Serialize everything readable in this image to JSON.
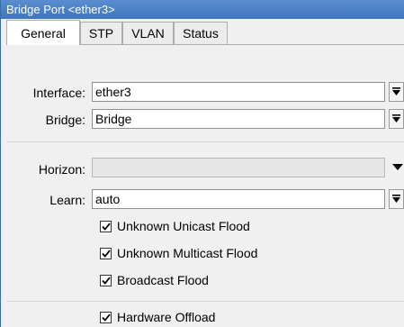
{
  "window": {
    "title": "Bridge Port <ether3>"
  },
  "tabs": [
    {
      "label": "General",
      "active": true
    },
    {
      "label": "STP",
      "active": false
    },
    {
      "label": "VLAN",
      "active": false
    },
    {
      "label": "Status",
      "active": false
    }
  ],
  "form": {
    "interface": {
      "label": "Interface:",
      "value": "ether3"
    },
    "bridge": {
      "label": "Bridge:",
      "value": "Bridge"
    },
    "horizon": {
      "label": "Horizon:",
      "value": ""
    },
    "learn": {
      "label": "Learn:",
      "value": "auto"
    }
  },
  "checkboxes": [
    {
      "label": "Unknown Unicast Flood",
      "checked": true
    },
    {
      "label": "Unknown Multicast Flood",
      "checked": true
    },
    {
      "label": "Broadcast Flood",
      "checked": true
    },
    {
      "label": "Hardware Offload",
      "checked": true
    }
  ],
  "icons": {
    "dropdown": "dropdown-arrow-icon",
    "expand": "expand-down-icon",
    "check": "check-mark-icon"
  },
  "colors": {
    "titlebar": "#4a80c6",
    "panel": "#f0f0f0"
  }
}
